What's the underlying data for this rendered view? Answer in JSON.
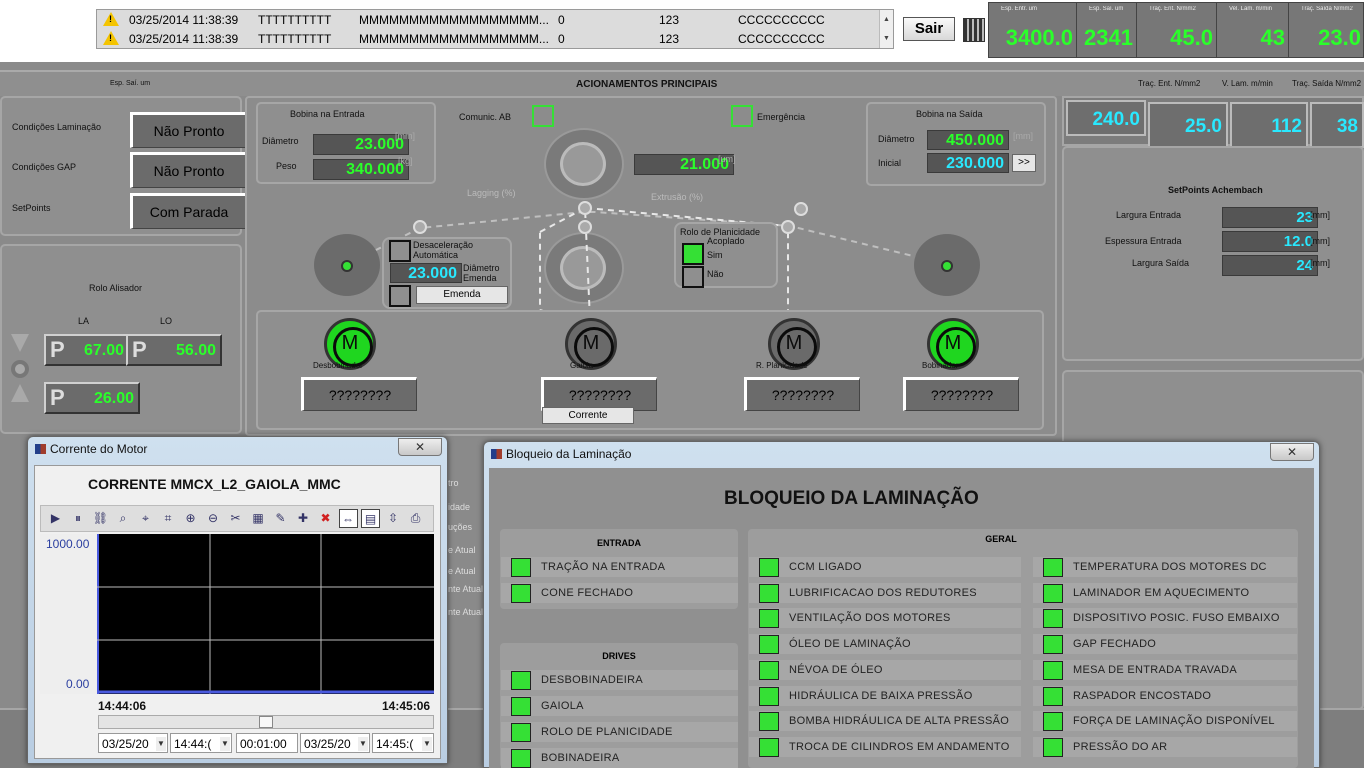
{
  "alarms": {
    "rows": [
      {
        "datetime": "03/25/2014 11:38:39",
        "col1": "TTTTTTTTTT",
        "col2": "MMMMMMMMMMMMMMMMMM...",
        "col3": "0",
        "col4": "123",
        "col5": "CCCCCCCCCC"
      },
      {
        "datetime": "03/25/2014 11:38:39",
        "col1": "TTTTTTTTTT",
        "col2": "MMMMMMMMMMMMMMMMMM...",
        "col3": "0",
        "col4": "123",
        "col5": "CCCCCCCCCC"
      }
    ]
  },
  "sair_label": "Sair",
  "top_meters": {
    "labels": [
      "Esp. Entr. um",
      "Esp. Saí. um",
      "Traç. Ent. N/mm2",
      "Vel. Lam. m/min",
      "Traç. Saída N/mm2"
    ],
    "values": [
      "3400.0",
      "2341",
      "45.0",
      "43",
      "23.0"
    ]
  },
  "header": {
    "title": "ACIONAMENTOS PRINCIPAIS",
    "esp_sai": "Esp. Saí. um",
    "trac_ent": "Traç. Ent. N/mm2",
    "vel_lam": "V. Lam. m/min",
    "trac_sai": "Traç. Saída N/mm2"
  },
  "right_meters": [
    "240.0",
    "25.0",
    "112",
    "38"
  ],
  "conditions": [
    {
      "label": "Condições Laminação",
      "value": "Não Pronto"
    },
    {
      "label": "Condições GAP",
      "value": "Não Pronto"
    },
    {
      "label": "SetPoints",
      "value": "Com Parada"
    }
  ],
  "rolo_alisador": {
    "title": "Rolo Alisador",
    "la": "LA",
    "lo": "LO",
    "p": "P",
    "la_value": "67.00",
    "lo_value": "56.00",
    "third_value": "26.00"
  },
  "bobina_entrada": {
    "title": "Bobina na Entrada",
    "diametro_label": "Diâmetro",
    "diametro": "23.000",
    "unit_mm": "[mm]",
    "peso_label": "Peso",
    "peso": "340.000",
    "unit_kg": "[kg]"
  },
  "comunic": "Comunic. AB",
  "emergencia": "Emergência",
  "gaiola_gap": {
    "value": "21.000",
    "unit": "[um]"
  },
  "lagging": "Lagging (%)",
  "extrusao": "Extrusão (%)",
  "bobina_saida": {
    "title": "Bobina na Saída",
    "diametro_label": "Diâmetro",
    "diametro": "450.000",
    "unit_mm": "[mm]",
    "inicial_label": "Inicial",
    "inicial": "230.000",
    "btn": ">>"
  },
  "desaceleracao": {
    "title": "Desaceleração Automática",
    "diametro": "23.000",
    "diametro_label": "Diâmetro Emenda",
    "emenda_btn": "Emenda"
  },
  "rolo_planicidade": {
    "title": "Rolo de Planicidade",
    "acoplado": "Acoplado",
    "sim": "Sim",
    "nao": "Não"
  },
  "setpoints_achembach": {
    "title": "SetPoints Achembach",
    "largura_entrada_label": "Largura Entrada",
    "largura_entrada": "23",
    "espessura_entrada_label": "Espessura Entrada",
    "espessura_entrada": "12.0",
    "largura_saida_label": "Largura Saída",
    "largura_saida": "24",
    "unit": "[mm]"
  },
  "motors": [
    {
      "label": "Desbobinador",
      "value": "????????"
    },
    {
      "label": "Gaiola",
      "value": "????????"
    },
    {
      "label": "R. Planicidade",
      "value": "????????"
    },
    {
      "label": "Bobinador",
      "value": "????????"
    }
  ],
  "motor_symbol": "M",
  "corrente_btn": "Corrente",
  "hidden_side_labels": [
    "tro",
    "idade",
    "uções",
    "e Atual",
    "e Atual",
    "nte Atual",
    "nte Atual"
  ],
  "motor_window": {
    "title": "Corrente do Motor",
    "heading": "CORRENTE MMCX_L2_GAIOLA_MMC",
    "close": "✕",
    "toolbar": [
      "▶",
      "⏸",
      "⛓",
      "⌕",
      "⌖",
      "⌗",
      "⊕",
      "⊖",
      "✂",
      "▦",
      "✎",
      "✚",
      "✖",
      "⇔",
      "▤",
      "⇳",
      "⎙"
    ],
    "chart": {
      "y_max": "1000.00",
      "y_min": "0.00",
      "x_start": "14:44:06",
      "x_end": "14:45:06"
    },
    "time_controls": [
      "03/25/20",
      "14:44:(",
      "00:01:00",
      "03/25/20",
      "14:45:("
    ]
  },
  "chart_data": {
    "type": "line",
    "title": "CORRENTE MMCX_L2_GAIOLA_MMC",
    "ylim": [
      0,
      1000
    ],
    "x": [
      "14:44:06",
      "14:45:06"
    ],
    "series": []
  },
  "bloqueio_window": {
    "title": "Bloqueio da Laminação",
    "close": "✕",
    "heading": "BLOQUEIO DA LAMINAÇÃO",
    "entrada": {
      "title": "ENTRADA",
      "items": [
        "TRAÇÃO NA ENTRADA",
        "CONE FECHADO"
      ]
    },
    "drives": {
      "title": "DRIVES",
      "items": [
        "DESBOBINADEIRA",
        "GAIOLA",
        "ROLO DE PLANICIDADE",
        "BOBINADEIRA"
      ]
    },
    "geral": {
      "title": "GERAL",
      "left": [
        "CCM LIGADO",
        "LUBRIFICACAO DOS REDUTORES",
        "VENTILAÇÃO DOS MOTORES",
        "ÓLEO DE LAMINAÇÃO",
        "NÉVOA DE ÓLEO",
        "HIDRÁULICA DE BAIXA PRESSÃO",
        "BOMBA HIDRÁULICA DE ALTA PRESSÃO",
        "TROCA DE CILINDROS EM ANDAMENTO"
      ],
      "right": [
        "TEMPERATURA DOS MOTORES DC",
        "LAMINADOR EM AQUECIMENTO",
        "DISPOSITIVO POSIC. FUSO EMBAIXO",
        "GAP FECHADO",
        "MESA DE ENTRADA TRAVADA",
        "RASPADOR ENCOSTADO",
        "FORÇA DE LAMINAÇÃO DISPONÍVEL",
        "PRESSÃO DO AR"
      ]
    }
  },
  "colors": {
    "green": "#35e035",
    "cyan": "#29e9ff",
    "digital_green": "#2aff2a",
    "bg": "#8a8a8a"
  }
}
